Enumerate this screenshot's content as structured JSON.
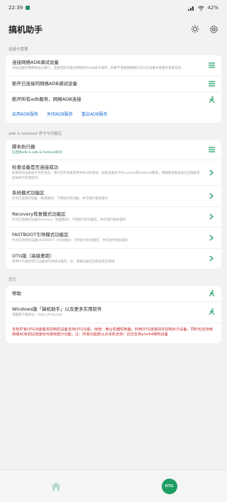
{
  "status": {
    "time": "22:39",
    "right": "42%"
  },
  "app": {
    "title": "搞机助手"
  },
  "sections": {
    "s1": "连接与管理",
    "s2": "adb & fastboot 命令与功能区",
    "s3": "其它"
  },
  "card1": {
    "r1_title": "连接网络ADB调试设备",
    "r1_desc": "添加设备的网络地址与端口，连接后即可通过网络执行adb命令操作，如果不清楚网络端口可以在设备中查看开发者选项。",
    "r2_title": "断开已连接的网络ADB调试设备",
    "r3_title": "断开所有adb服务，网络ADB连接",
    "links": [
      "启用ADB服务",
      "关闭ADB服务",
      "重启ADB服务"
    ]
  },
  "card2": [
    {
      "title": "脚本执行器",
      "desc": "已连接adb & adb & fastboot命令"
    },
    {
      "title": "检查设备是否连接成功",
      "desc": "如果你的设备处于开机状态，请打开开发者选项中的USB调试；如果设备处于Recovery或fastboot模式，请确保设备驱动已正确安装后再执行检测操作。"
    },
    {
      "title": "系统模式功能区",
      "desc": "针对已连接的设备（系统模式）下所执行的功能，并可进行相关操作"
    },
    {
      "title": "Recovery恢复模式功能区",
      "desc": "针对已连接的设备Recovery（恢复模式）下所执行的功能区，并可进行相关操作"
    },
    {
      "title": "FASTBOOT引导模式功能区",
      "desc": "针对已连接的设备FASTBOOT（引导模式）下所执行的功能区，并可进行相关操作"
    },
    {
      "title": "OTG版（高级差距）",
      "desc": "利用OTG线对其它设备进行调试与操作，主：需要设备已连接且开启调试"
    }
  ],
  "card3": {
    "r1_title": "帮助",
    "r2_title": "Windows版「搞机助手」以及更多实用软件",
    "r2_desc": "电脑版下载地址：https://lsdy.top/",
    "note": "本软件有OTG功能版本控制机设备支持OTG功能，用途：两台机器短电脑。利用OTG连接另外控制对方设备，同时也支持用网络ADB调试连接也可使用部分功能。注：所有功能默认对本机无效！且仅支持arm64架构设备"
  },
  "bottom": {
    "otg_label": "OTG"
  },
  "colors": {
    "accent": "#1e9e63",
    "link": "#1e6fd9",
    "warning": "#c62828"
  }
}
